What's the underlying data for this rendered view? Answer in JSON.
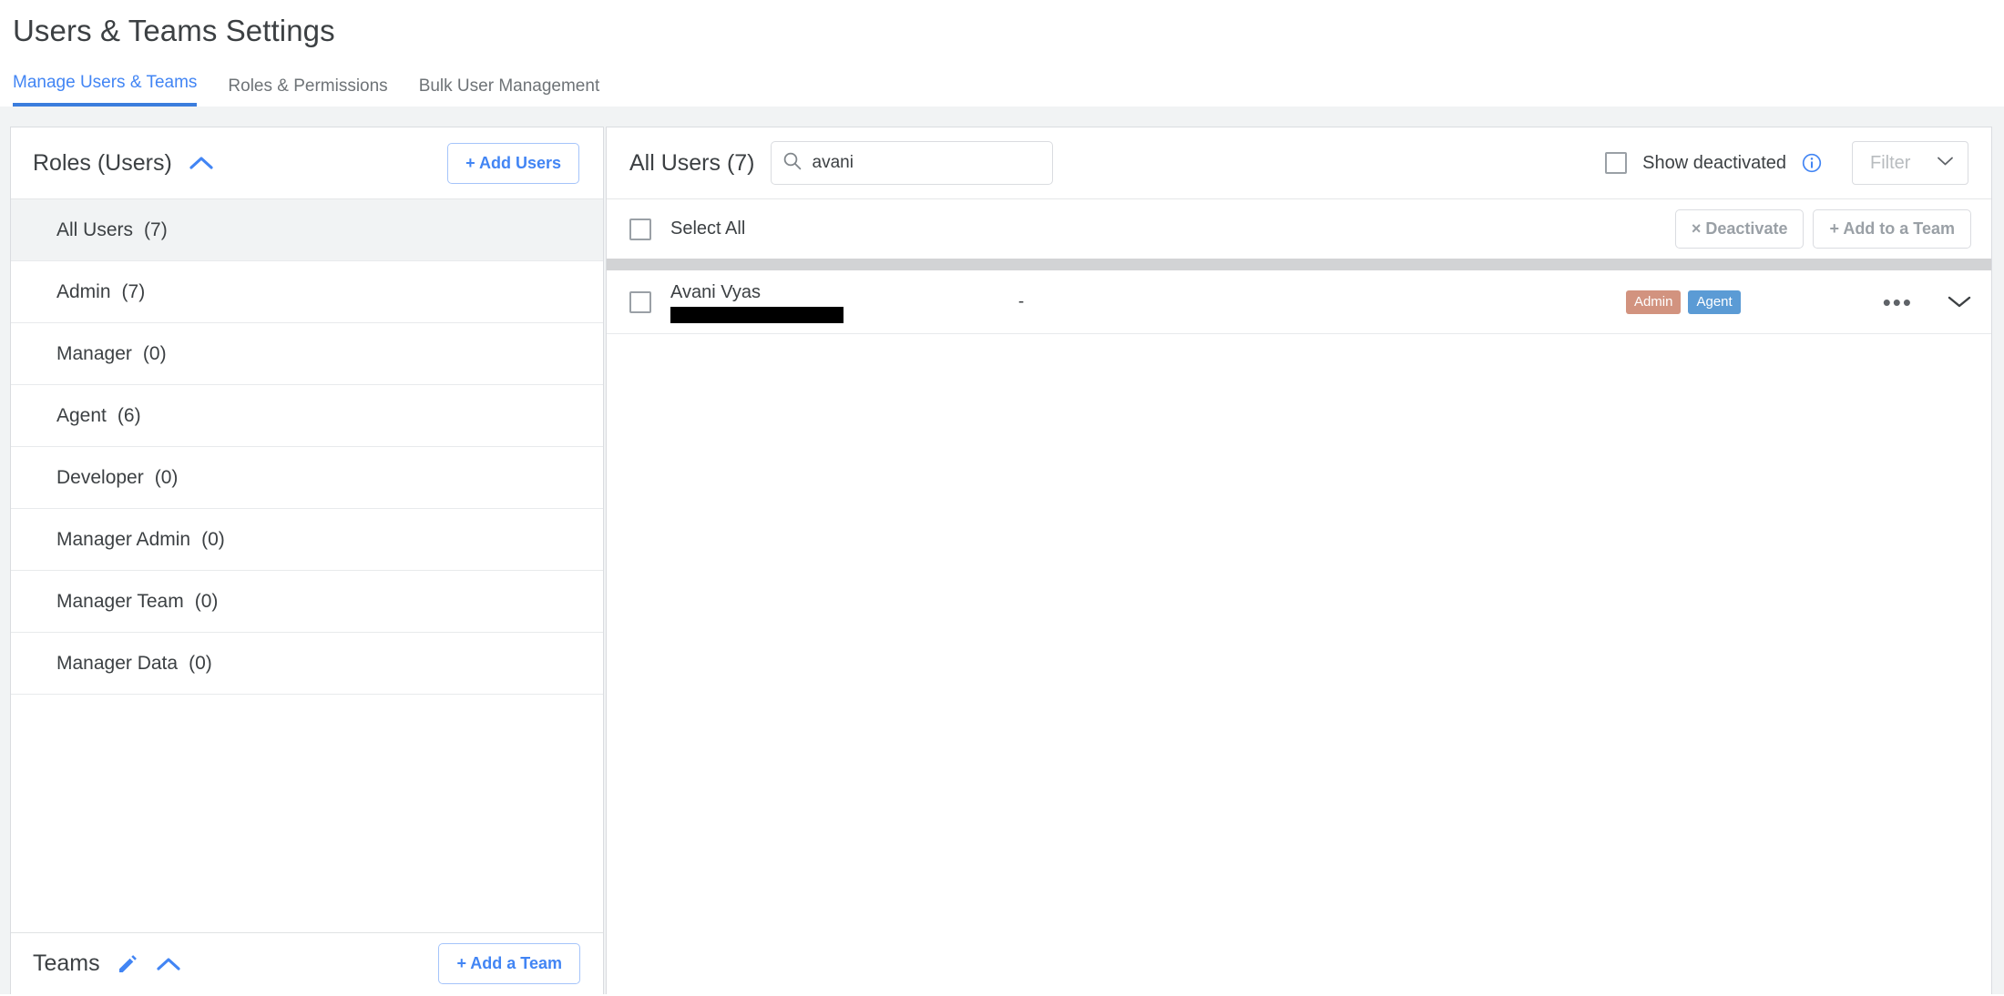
{
  "header": {
    "title": "Users & Teams Settings",
    "tabs": [
      {
        "label": "Manage Users & Teams",
        "active": true
      },
      {
        "label": "Roles & Permissions",
        "active": false
      },
      {
        "label": "Bulk User Management",
        "active": false
      }
    ]
  },
  "roles_panel": {
    "title": "Roles (Users)",
    "collapse_icon": "chevron-up-icon",
    "add_users_label": "+ Add Users",
    "items": [
      {
        "name": "All Users",
        "count": "(7)",
        "selected": true
      },
      {
        "name": "Admin",
        "count": "(7)",
        "selected": false
      },
      {
        "name": "Manager",
        "count": "(0)",
        "selected": false
      },
      {
        "name": "Agent",
        "count": "(6)",
        "selected": false
      },
      {
        "name": "Developer",
        "count": "(0)",
        "selected": false
      },
      {
        "name": "Manager Admin",
        "count": "(0)",
        "selected": false
      },
      {
        "name": "Manager Team",
        "count": "(0)",
        "selected": false
      },
      {
        "name": "Manager Data",
        "count": "(0)",
        "selected": false
      }
    ]
  },
  "teams_panel": {
    "title": "Teams",
    "edit_icon": "pencil-icon",
    "collapse_icon": "chevron-up-icon",
    "add_team_label": "+ Add a Team"
  },
  "users_panel": {
    "title": "All Users (7)",
    "search": {
      "icon": "search-icon",
      "value": "avani",
      "placeholder": "Search"
    },
    "show_deactivated": {
      "label": "Show deactivated",
      "checked": false,
      "info_icon": "info-icon"
    },
    "filter": {
      "label": "Filter",
      "icon": "chevron-down-icon",
      "disabled": true
    },
    "select_all": {
      "label": "Select All",
      "checked": false
    },
    "bulk_actions": [
      {
        "label": "× Deactivate",
        "disabled": true
      },
      {
        "label": "+ Add to a Team",
        "disabled": true
      }
    ],
    "rows": [
      {
        "name": "Avani Vyas",
        "email_redacted": true,
        "team": "-",
        "badges": [
          {
            "label": "Admin",
            "color": "#d2937f"
          },
          {
            "label": "Agent",
            "color": "#5b9bd5"
          }
        ],
        "more_icon": "more-horizontal-icon",
        "expand_icon": "chevron-down-icon",
        "checked": false
      }
    ]
  },
  "colors": {
    "accent_blue": "#4285f4",
    "tab_underline": "#3b7ddd",
    "page_bg": "#f1f3f4",
    "badge_admin": "#d2937f",
    "badge_agent": "#5b9bd5",
    "scrollbar": "#d2d3d5"
  }
}
